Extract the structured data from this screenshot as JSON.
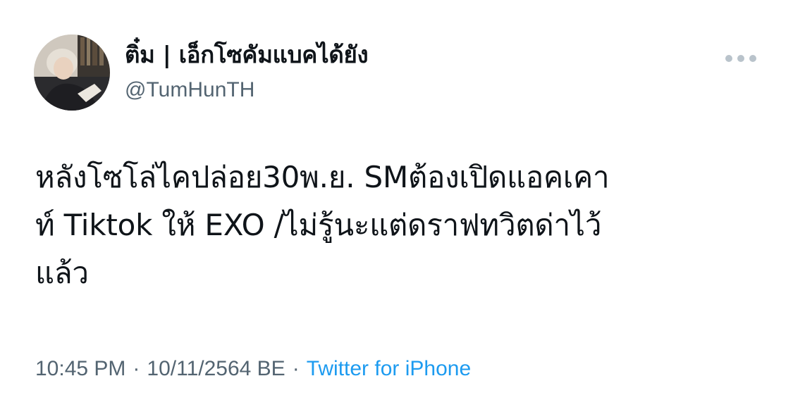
{
  "tweet": {
    "author": {
      "display_name": "ติ๋ม | เอ็กโซคัมแบคได้ยัง",
      "handle": "@TumHunTH",
      "avatar_icon": "profile-photo"
    },
    "more_icon": "more-horizontal-icon",
    "text": "หลังโซโล่ไคปล่อย30พ.ย. SMต้องเปิดแอคเคา\nท์ Tiktok  ให้ EXO /ไม่รู้นะแต่ดราฟทวิตด่าไว้\nแล้ว",
    "time": "10:45 PM",
    "separator": "·",
    "date": "10/11/2564 BE",
    "source": "Twitter for iPhone"
  },
  "colors": {
    "text": "#0f1419",
    "secondary": "#536471",
    "link": "#1d9bf0",
    "more_dots": "#b9c3cb"
  }
}
